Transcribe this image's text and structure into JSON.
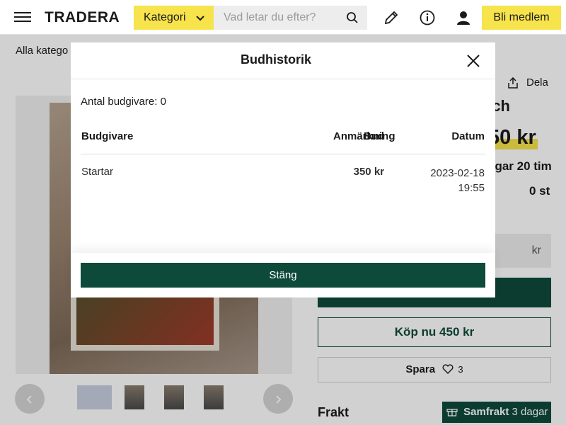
{
  "header": {
    "logo": "TRADERA",
    "category_label": "Kategori",
    "search_placeholder": "Vad letar du efter?",
    "member_label": "Bli medlem"
  },
  "page": {
    "breadcrumb": "Alla katego",
    "share_label": "Dela",
    "title_fragment": "tch",
    "price_fragment": "50 kr",
    "time_fragment": "agar 20 tim",
    "count_fragment": "0 st",
    "bid_unit": "kr",
    "buy_now_label": "Köp nu 450 kr",
    "save_label": "Spara",
    "save_count": "3",
    "shipping_heading": "Frakt",
    "samfrakt_label": "Samfrakt",
    "samfrakt_days": "3 dagar"
  },
  "modal": {
    "title": "Budhistorik",
    "bidder_count": "Antal budgivare: 0",
    "columns": {
      "bidder": "Budgivare",
      "bid": "Bud",
      "note": "Anmärkning",
      "date": "Datum"
    },
    "rows": [
      {
        "bidder": "Startar",
        "bid": "350 kr",
        "note": "",
        "date_line1": "2023-02-18",
        "date_line2": "19:55"
      }
    ],
    "close_label": "Stäng"
  },
  "colors": {
    "brand_yellow": "#f7e34b",
    "brand_green": "#0e4a3a"
  },
  "icons": [
    "menu-icon",
    "chevron-down-icon",
    "search-icon",
    "pencil-icon",
    "info-icon",
    "user-icon",
    "share-icon",
    "heart-icon",
    "gift-icon",
    "close-icon",
    "chevron-left-icon",
    "chevron-right-icon"
  ]
}
